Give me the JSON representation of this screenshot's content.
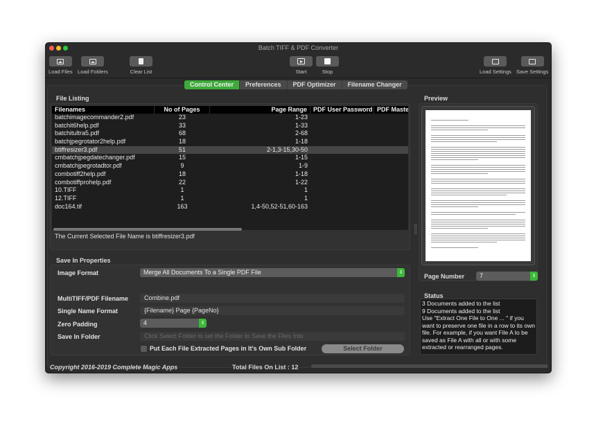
{
  "window": {
    "title": "Batch TIFF & PDF Converter"
  },
  "toolbar": {
    "load_files": "Load Files",
    "load_folders": "Load Folders",
    "clear_list": "Clear List",
    "start": "Start",
    "stop": "Stop",
    "load_settings": "Load Settings",
    "save_settings": "Save Settings"
  },
  "tabs": [
    {
      "label": "Control Center",
      "active": true
    },
    {
      "label": "Preferences",
      "active": false
    },
    {
      "label": "PDF Optimizer",
      "active": false
    },
    {
      "label": "Filename Changer",
      "active": false
    }
  ],
  "file_listing": {
    "title": "File Listing",
    "columns": [
      "Filenames",
      "No of Pages",
      "Page Range",
      "PDF User Password",
      "PDF Master I"
    ],
    "rows": [
      {
        "name": "batchimagecommander2.pdf",
        "pages": "23",
        "range": "1-23",
        "user_pw": "",
        "master_pw": ""
      },
      {
        "name": "batchit6help.pdf",
        "pages": "33",
        "range": "1-33",
        "user_pw": "",
        "master_pw": ""
      },
      {
        "name": "batchitultra5.pdf",
        "pages": "68",
        "range": "2-68",
        "user_pw": "",
        "master_pw": ""
      },
      {
        "name": "batchjpegrotator2help.pdf",
        "pages": "18",
        "range": "1-18",
        "user_pw": "",
        "master_pw": ""
      },
      {
        "name": "btiffresizer3.pdf",
        "pages": "51",
        "range": "2-1,3-15,30-50",
        "user_pw": "",
        "master_pw": "",
        "selected": true
      },
      {
        "name": "cmbatchjpegdatechanger.pdf",
        "pages": "15",
        "range": "1-15",
        "user_pw": "",
        "master_pw": ""
      },
      {
        "name": "cmbatchjpegrotadtor.pdf",
        "pages": "9",
        "range": "1-9",
        "user_pw": "",
        "master_pw": ""
      },
      {
        "name": "combotiff2help.pdf",
        "pages": "18",
        "range": "1-18",
        "user_pw": "",
        "master_pw": ""
      },
      {
        "name": "combotiffprohelp.pdf",
        "pages": "22",
        "range": "1-22",
        "user_pw": "",
        "master_pw": ""
      },
      {
        "name": "10.TIFF",
        "pages": "1",
        "range": "1",
        "user_pw": "",
        "master_pw": ""
      },
      {
        "name": "12.TIFF",
        "pages": "1",
        "range": "1",
        "user_pw": "",
        "master_pw": ""
      },
      {
        "name": "doc164.tif",
        "pages": "163",
        "range": "1,4-50,52-51,60-163",
        "user_pw": "",
        "master_pw": ""
      }
    ],
    "selected_text": "The Current Selected File Name is btiffresizer3.pdf"
  },
  "save_properties": {
    "title": "Save In Properties",
    "image_format_label": "Image Format",
    "image_format_value": "Merge All Documents To a Single PDF File",
    "multi_filename_label": "MultiTIFF/PDF Filename",
    "multi_filename_value": "Combine.pdf",
    "single_name_label": "Single Name Format",
    "single_name_value": "{Filename} Page {PageNo}",
    "zero_padding_label": "Zero Padding",
    "zero_padding_value": "4",
    "save_folder_label": "Save In Folder",
    "save_folder_placeholder": "Click Select Folder to set the Folder to Save the Files Into",
    "subfolder_checkbox_label": "Put Each File Extracted Pages in It's Own Sub Folder",
    "subfolder_checked": false,
    "select_folder_button": "Select Folder"
  },
  "preview": {
    "title": "Preview",
    "page_number_label": "Page Number",
    "page_number_value": "7"
  },
  "status": {
    "title": "Status",
    "lines": [
      "3 Documents added to the list",
      "9 Documents added to the list",
      "Use \"Extract One File to One ... \" if you want to preserve one file in a row to its own file. For example, if you want File A to be saved as File A with all or with some extracted or rearranged pages."
    ]
  },
  "footer": {
    "copyright": "Copyright 2016-2019 Complete Magic Apps",
    "total_files": "Total Files On List : 12",
    "progress": 0
  },
  "colors": {
    "accent_green": "#3eaa3a",
    "window_bg": "#2b2b2b"
  }
}
